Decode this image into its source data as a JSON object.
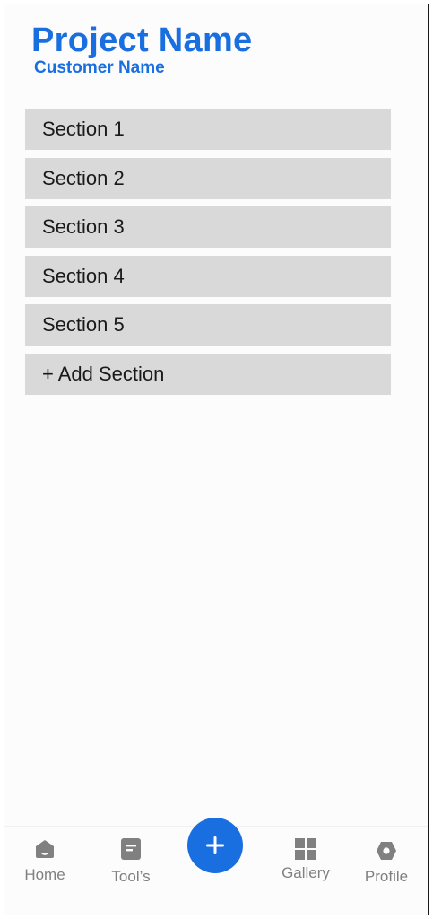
{
  "header": {
    "project_title": "Project Name",
    "customer_name": "Customer Name"
  },
  "sections": [
    {
      "label": "Section 1"
    },
    {
      "label": "Section 2"
    },
    {
      "label": "Section 3"
    },
    {
      "label": "Section 4"
    },
    {
      "label": "Section 5"
    }
  ],
  "add_section_label": "+ Add Section",
  "bottom_nav": {
    "home": {
      "label": "Home",
      "icon": "home-icon"
    },
    "tools": {
      "label": "Tool’s",
      "icon": "document-icon"
    },
    "add": {
      "icon": "plus-icon"
    },
    "gallery": {
      "label": "Gallery",
      "icon": "grid-icon"
    },
    "profile": {
      "label": "Profile",
      "icon": "hexagon-icon"
    }
  },
  "colors": {
    "accent": "#1a6fe0",
    "section_bg": "#d9d9d9",
    "nav_icon": "#808080"
  }
}
